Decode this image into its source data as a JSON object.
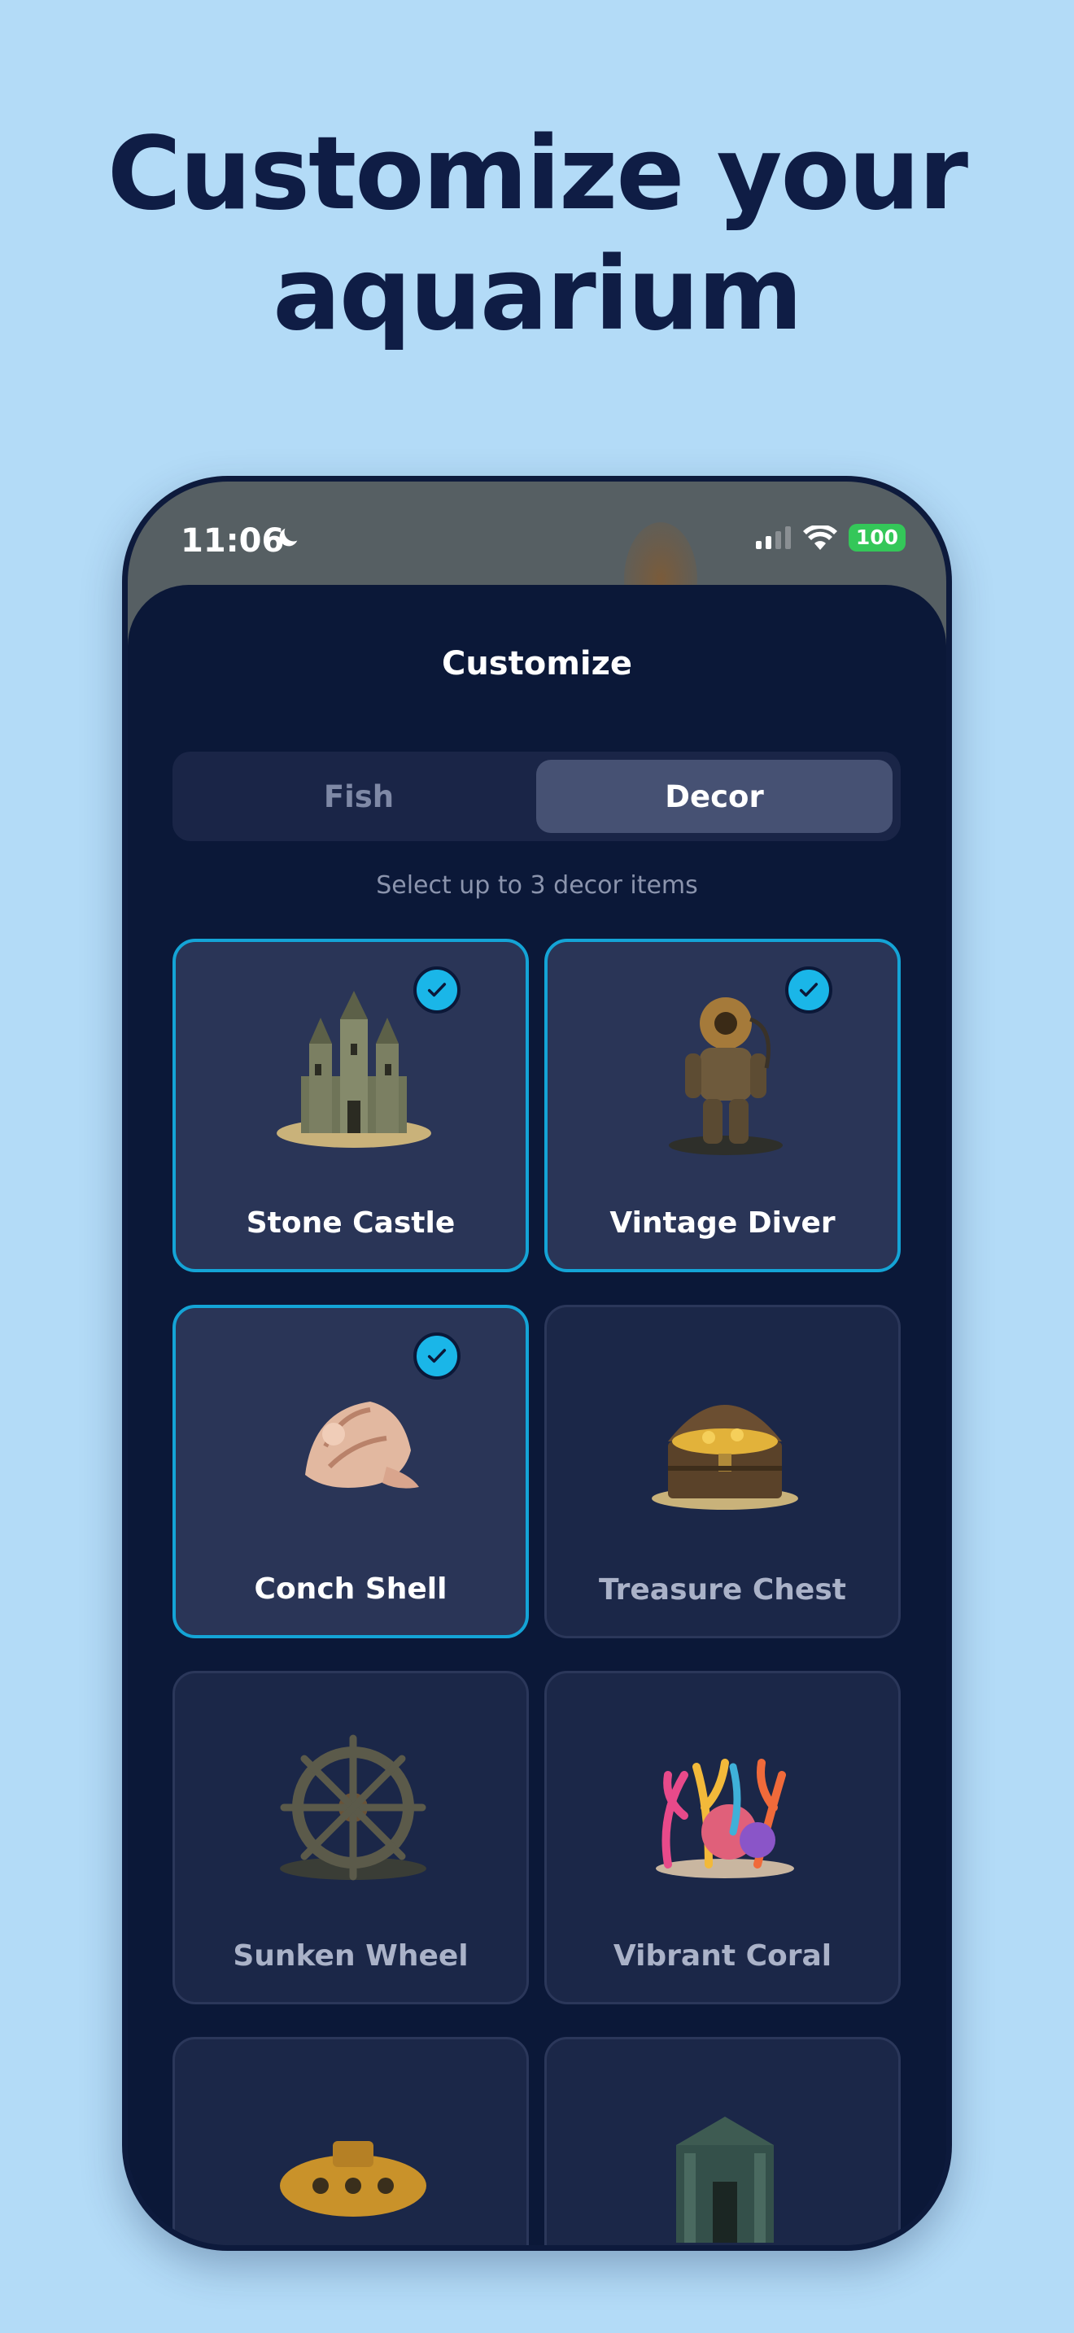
{
  "headline": {
    "line1": "Customize your",
    "line2": "aquarium"
  },
  "status_bar": {
    "time": "11:06",
    "battery": "100"
  },
  "sheet": {
    "title": "Customize",
    "tabs": [
      {
        "label": "Fish",
        "selected": false
      },
      {
        "label": "Decor",
        "selected": true
      }
    ],
    "hint": "Select up to 3 decor items",
    "items": [
      {
        "label": "Stone Castle",
        "selected": true,
        "icon": "castle-icon"
      },
      {
        "label": "Vintage Diver",
        "selected": true,
        "icon": "diver-icon"
      },
      {
        "label": "Conch Shell",
        "selected": true,
        "icon": "shell-icon"
      },
      {
        "label": "Treasure Chest",
        "selected": false,
        "icon": "treasure-chest-icon"
      },
      {
        "label": "Sunken Wheel",
        "selected": false,
        "icon": "ship-wheel-icon"
      },
      {
        "label": "Vibrant Coral",
        "selected": false,
        "icon": "coral-icon"
      },
      {
        "label": "",
        "selected": false,
        "icon": "submarine-icon"
      },
      {
        "label": "",
        "selected": false,
        "icon": "temple-ruin-icon"
      }
    ]
  },
  "colors": {
    "page_bg": "#b3dbf7",
    "headline": "#0f1d45",
    "sheet_bg": "#0b1838",
    "accent": "#1ab6e8",
    "battery": "#34c759"
  }
}
